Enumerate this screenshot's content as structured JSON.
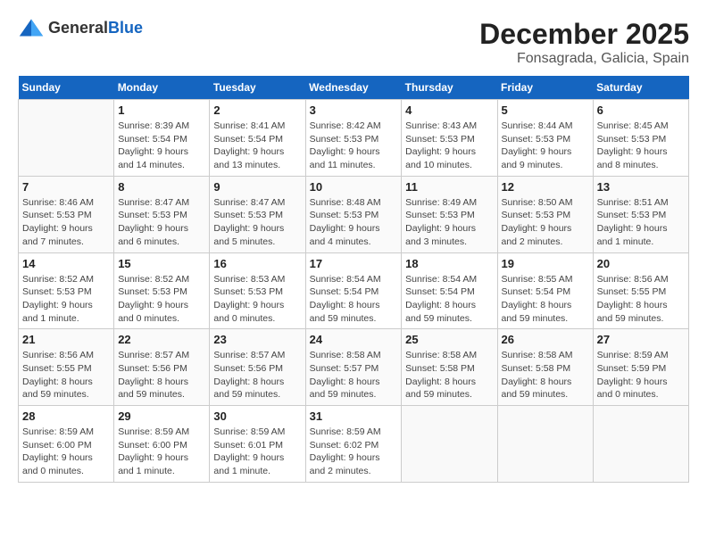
{
  "header": {
    "logo": {
      "general": "General",
      "blue": "Blue"
    },
    "month_year": "December 2025",
    "location": "Fonsagrada, Galicia, Spain"
  },
  "calendar": {
    "days_of_week": [
      "Sunday",
      "Monday",
      "Tuesday",
      "Wednesday",
      "Thursday",
      "Friday",
      "Saturday"
    ],
    "weeks": [
      [
        {
          "day": "",
          "info": ""
        },
        {
          "day": "1",
          "info": "Sunrise: 8:39 AM\nSunset: 5:54 PM\nDaylight: 9 hours\nand 14 minutes."
        },
        {
          "day": "2",
          "info": "Sunrise: 8:41 AM\nSunset: 5:54 PM\nDaylight: 9 hours\nand 13 minutes."
        },
        {
          "day": "3",
          "info": "Sunrise: 8:42 AM\nSunset: 5:53 PM\nDaylight: 9 hours\nand 11 minutes."
        },
        {
          "day": "4",
          "info": "Sunrise: 8:43 AM\nSunset: 5:53 PM\nDaylight: 9 hours\nand 10 minutes."
        },
        {
          "day": "5",
          "info": "Sunrise: 8:44 AM\nSunset: 5:53 PM\nDaylight: 9 hours\nand 9 minutes."
        },
        {
          "day": "6",
          "info": "Sunrise: 8:45 AM\nSunset: 5:53 PM\nDaylight: 9 hours\nand 8 minutes."
        }
      ],
      [
        {
          "day": "7",
          "info": "Sunrise: 8:46 AM\nSunset: 5:53 PM\nDaylight: 9 hours\nand 7 minutes."
        },
        {
          "day": "8",
          "info": "Sunrise: 8:47 AM\nSunset: 5:53 PM\nDaylight: 9 hours\nand 6 minutes."
        },
        {
          "day": "9",
          "info": "Sunrise: 8:47 AM\nSunset: 5:53 PM\nDaylight: 9 hours\nand 5 minutes."
        },
        {
          "day": "10",
          "info": "Sunrise: 8:48 AM\nSunset: 5:53 PM\nDaylight: 9 hours\nand 4 minutes."
        },
        {
          "day": "11",
          "info": "Sunrise: 8:49 AM\nSunset: 5:53 PM\nDaylight: 9 hours\nand 3 minutes."
        },
        {
          "day": "12",
          "info": "Sunrise: 8:50 AM\nSunset: 5:53 PM\nDaylight: 9 hours\nand 2 minutes."
        },
        {
          "day": "13",
          "info": "Sunrise: 8:51 AM\nSunset: 5:53 PM\nDaylight: 9 hours\nand 1 minute."
        }
      ],
      [
        {
          "day": "14",
          "info": "Sunrise: 8:52 AM\nSunset: 5:53 PM\nDaylight: 9 hours\nand 1 minute."
        },
        {
          "day": "15",
          "info": "Sunrise: 8:52 AM\nSunset: 5:53 PM\nDaylight: 9 hours\nand 0 minutes."
        },
        {
          "day": "16",
          "info": "Sunrise: 8:53 AM\nSunset: 5:53 PM\nDaylight: 9 hours\nand 0 minutes."
        },
        {
          "day": "17",
          "info": "Sunrise: 8:54 AM\nSunset: 5:54 PM\nDaylight: 8 hours\nand 59 minutes."
        },
        {
          "day": "18",
          "info": "Sunrise: 8:54 AM\nSunset: 5:54 PM\nDaylight: 8 hours\nand 59 minutes."
        },
        {
          "day": "19",
          "info": "Sunrise: 8:55 AM\nSunset: 5:54 PM\nDaylight: 8 hours\nand 59 minutes."
        },
        {
          "day": "20",
          "info": "Sunrise: 8:56 AM\nSunset: 5:55 PM\nDaylight: 8 hours\nand 59 minutes."
        }
      ],
      [
        {
          "day": "21",
          "info": "Sunrise: 8:56 AM\nSunset: 5:55 PM\nDaylight: 8 hours\nand 59 minutes."
        },
        {
          "day": "22",
          "info": "Sunrise: 8:57 AM\nSunset: 5:56 PM\nDaylight: 8 hours\nand 59 minutes."
        },
        {
          "day": "23",
          "info": "Sunrise: 8:57 AM\nSunset: 5:56 PM\nDaylight: 8 hours\nand 59 minutes."
        },
        {
          "day": "24",
          "info": "Sunrise: 8:58 AM\nSunset: 5:57 PM\nDaylight: 8 hours\nand 59 minutes."
        },
        {
          "day": "25",
          "info": "Sunrise: 8:58 AM\nSunset: 5:58 PM\nDaylight: 8 hours\nand 59 minutes."
        },
        {
          "day": "26",
          "info": "Sunrise: 8:58 AM\nSunset: 5:58 PM\nDaylight: 8 hours\nand 59 minutes."
        },
        {
          "day": "27",
          "info": "Sunrise: 8:59 AM\nSunset: 5:59 PM\nDaylight: 9 hours\nand 0 minutes."
        }
      ],
      [
        {
          "day": "28",
          "info": "Sunrise: 8:59 AM\nSunset: 6:00 PM\nDaylight: 9 hours\nand 0 minutes."
        },
        {
          "day": "29",
          "info": "Sunrise: 8:59 AM\nSunset: 6:00 PM\nDaylight: 9 hours\nand 1 minute."
        },
        {
          "day": "30",
          "info": "Sunrise: 8:59 AM\nSunset: 6:01 PM\nDaylight: 9 hours\nand 1 minute."
        },
        {
          "day": "31",
          "info": "Sunrise: 8:59 AM\nSunset: 6:02 PM\nDaylight: 9 hours\nand 2 minutes."
        },
        {
          "day": "",
          "info": ""
        },
        {
          "day": "",
          "info": ""
        },
        {
          "day": "",
          "info": ""
        }
      ]
    ]
  }
}
